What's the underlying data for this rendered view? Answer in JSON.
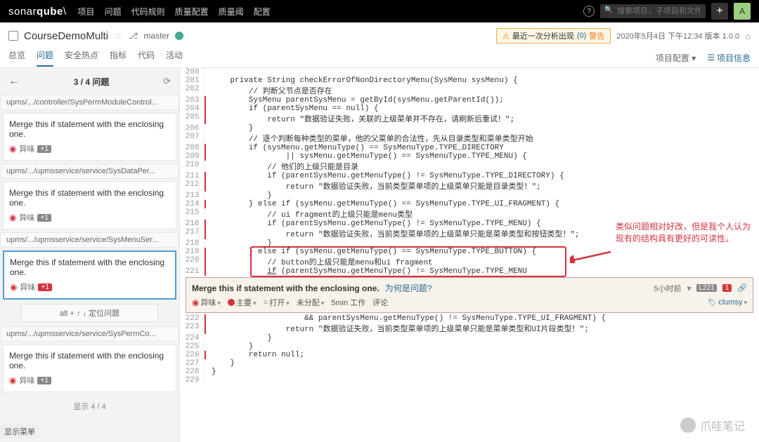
{
  "topbar": {
    "logo1": "sonar",
    "logo2": "qube",
    "nav": [
      "项目",
      "问题",
      "代码规则",
      "质量配置",
      "质量阈",
      "配置"
    ],
    "search_placeholder": "搜索项目，子项目和文件",
    "plus": "+",
    "avatar": "A"
  },
  "header": {
    "project": "CourseDemoMulti",
    "branch": "master",
    "warn_prefix": "最近一次分析出现",
    "warn_count": "(0)",
    "warn_label": "警告",
    "timestamp": "2020年5月4日 下午12:34  版本 1.0.0",
    "tabs": [
      "总览",
      "问题",
      "安全热点",
      "指标",
      "代码",
      "活动"
    ],
    "config_link": "项目配置 ▾",
    "info_link": "项目信息"
  },
  "sidebar": {
    "counter": "3 / 4 问题",
    "files": [
      "upms/.../controller/SysPermModuleControl...",
      "upms/.../upmsservice/service/SysDataPer...",
      "upms/.../upmsservice/service/SysMenuSer...",
      "upms/.../upmsservice/service/SysPermCo..."
    ],
    "issue_msg": "Merge this if statement with the enclosing one.",
    "smell_label": "异味",
    "plus1": "+1",
    "hint": "alt + ↑ ↓ 定位问题",
    "footer": "显示 4 / 4"
  },
  "code": {
    "lines": [
      {
        "n": 200,
        "m": false,
        "t": ""
      },
      {
        "n": 201,
        "m": false,
        "t": "    <kw>private</kw> String checkErrorOfNonDirectoryMenu(SysMenu sysMenu) {"
      },
      {
        "n": 202,
        "m": false,
        "t": "        <cm>// 判断父节点是否存在</cm>"
      },
      {
        "n": 203,
        "m": true,
        "t": "        SysMenu parentSysMenu = getById(sysMenu.getParentId());"
      },
      {
        "n": 204,
        "m": true,
        "t": "        <kw>if</kw> (parentSysMenu == <kw>null</kw>) {"
      },
      {
        "n": 205,
        "m": true,
        "t": "            <kw>return</kw> <str>\"数据验证失败，关联的上级菜单并不存在，请刷新后重试！\"</str>;"
      },
      {
        "n": 206,
        "m": false,
        "t": "        }"
      },
      {
        "n": 207,
        "m": false,
        "t": "        <cm>// 逐个判断每种类型的菜单，他的父菜单的合法性，先从目录类型和菜单类型开始</cm>"
      },
      {
        "n": 208,
        "m": true,
        "t": "        <kw>if</kw> (sysMenu.getMenuType() == SysMenuType.TYPE_DIRECTORY"
      },
      {
        "n": 209,
        "m": true,
        "t": "                || sysMenu.getMenuType() == SysMenuType.TYPE_MENU) {"
      },
      {
        "n": 210,
        "m": false,
        "t": "            <cm>// 他们的上级只能是目录</cm>"
      },
      {
        "n": 211,
        "m": true,
        "t": "            <kw>if</kw> (parentSysMenu.getMenuType() != SysMenuType.TYPE_DIRECTORY) {"
      },
      {
        "n": 212,
        "m": true,
        "t": "                <kw>return</kw> <str>\"数据验证失败，当前类型菜单项的上级菜单只能是目录类型！\"</str>;"
      },
      {
        "n": 213,
        "m": false,
        "t": "            }"
      },
      {
        "n": 214,
        "m": true,
        "t": "        } <kw>else if</kw> (sysMenu.getMenuType() == SysMenuType.TYPE_UI_FRAGMENT) {"
      },
      {
        "n": 215,
        "m": false,
        "t": "            <cm>// ui fragment的上级只能是menu类型</cm>"
      },
      {
        "n": 216,
        "m": true,
        "t": "            <kw>if</kw> (parentSysMenu.getMenuType() != SysMenuType.TYPE_MENU) {"
      },
      {
        "n": 217,
        "m": true,
        "t": "                <kw>return</kw> <str>\"数据验证失败，当前类型菜单项的上级菜单只能是菜单类型和按钮类型！\"</str>;"
      },
      {
        "n": 218,
        "m": false,
        "t": "            }"
      },
      {
        "n": 219,
        "m": true,
        "t": "        } <kw>else if</kw> (sysMenu.getMenuType() == SysMenuType.TYPE_BUTTON) {"
      },
      {
        "n": 220,
        "m": true,
        "t": "            <cm>// button的上级只能是menu和ui fragment</cm>"
      },
      {
        "n": 221,
        "m": true,
        "t": "            <u><kw>if</kw></u> (parentSysMenu.getMenuType() != SysMenuType.TYPE_MENU"
      }
    ],
    "lines2": [
      {
        "n": 222,
        "m": true,
        "t": "                    && parentSysMenu.getMenuType() != SysMenuType.TYPE_UI_FRAGMENT) {"
      },
      {
        "n": 223,
        "m": true,
        "t": "                <kw>return</kw> <str>\"数据验证失败，当前类型菜单项的上级菜单只能是菜单类型和UI片段类型！\"</str>;"
      },
      {
        "n": 224,
        "m": false,
        "t": "            }"
      },
      {
        "n": 225,
        "m": false,
        "t": "        }"
      },
      {
        "n": 226,
        "m": true,
        "t": "        <kw>return null</kw>;"
      },
      {
        "n": 227,
        "m": false,
        "t": "    }"
      },
      {
        "n": 228,
        "m": false,
        "t": "}"
      },
      {
        "n": 229,
        "m": false,
        "t": ""
      }
    ]
  },
  "annotation": "类似问题相对好改，但是我个人认为\n现有的结构具有更好的可读性。",
  "issue_detail": {
    "msg": "Merge this if statement with the enclosing one.",
    "why": "为何是问题?",
    "time": "5小时前",
    "line": "L221",
    "count": "1",
    "smell": "异味",
    "severity": "主要",
    "status": "打开",
    "assign": "未分配",
    "effort": "5min 工作",
    "comment": "评论",
    "tag": "clumsy"
  },
  "watermark": "爪哇笔记",
  "bottom": "显示菜单"
}
